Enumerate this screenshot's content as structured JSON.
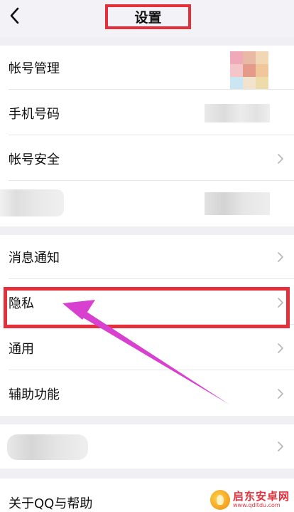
{
  "header": {
    "title": "设置",
    "back_icon": "chevron-left-icon"
  },
  "account_group": {
    "items": [
      {
        "label": "帐号管理"
      },
      {
        "label": "手机号码"
      },
      {
        "label": "帐号安全"
      }
    ]
  },
  "notify_group": {
    "items": [
      {
        "label": "消息通知"
      },
      {
        "label": "隐私"
      },
      {
        "label": "通用"
      },
      {
        "label": "辅助功能"
      }
    ]
  },
  "about_group": {
    "items": [
      {
        "label": "关于QQ与帮助"
      }
    ]
  },
  "colors": {
    "highlight": "#e4303a",
    "arrow": "#d840d0"
  },
  "watermark": {
    "name": "启东安卓网",
    "url": "www.qdltdu.com"
  }
}
